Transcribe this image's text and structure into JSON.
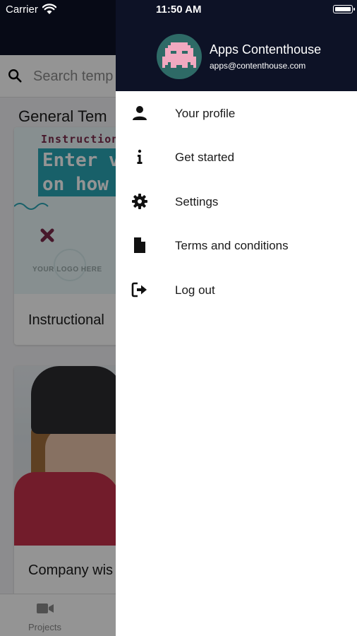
{
  "status_bar": {
    "carrier": "Carrier",
    "time": "11:50 AM"
  },
  "background": {
    "search_placeholder": "Search temp",
    "section_title": "General Tem",
    "card1": {
      "thumb_heading": "Instruction",
      "thumb_line1": "Enter v",
      "thumb_line2": "on how",
      "thumb_logo": "YOUR LOGO HERE",
      "title": "Instructional"
    },
    "card2": {
      "title": "Company wis"
    },
    "tab_label": "Projects"
  },
  "drawer": {
    "user": {
      "name": "Apps Contenthouse",
      "email": "apps@contenthouse.com",
      "avatar_icon": "pixel-invader-icon"
    },
    "menu": [
      {
        "label": "Your profile",
        "icon": "person-icon"
      },
      {
        "label": "Get started",
        "icon": "info-icon"
      },
      {
        "label": "Settings",
        "icon": "gear-icon"
      },
      {
        "label": "Terms and conditions",
        "icon": "document-icon"
      },
      {
        "label": "Log out",
        "icon": "logout-icon"
      }
    ]
  },
  "colors": {
    "header_bg": "#0d1226",
    "avatar_bg": "#2e6a66",
    "avatar_fg": "#f1a9c0",
    "accent_band": "#2aa5b5"
  }
}
